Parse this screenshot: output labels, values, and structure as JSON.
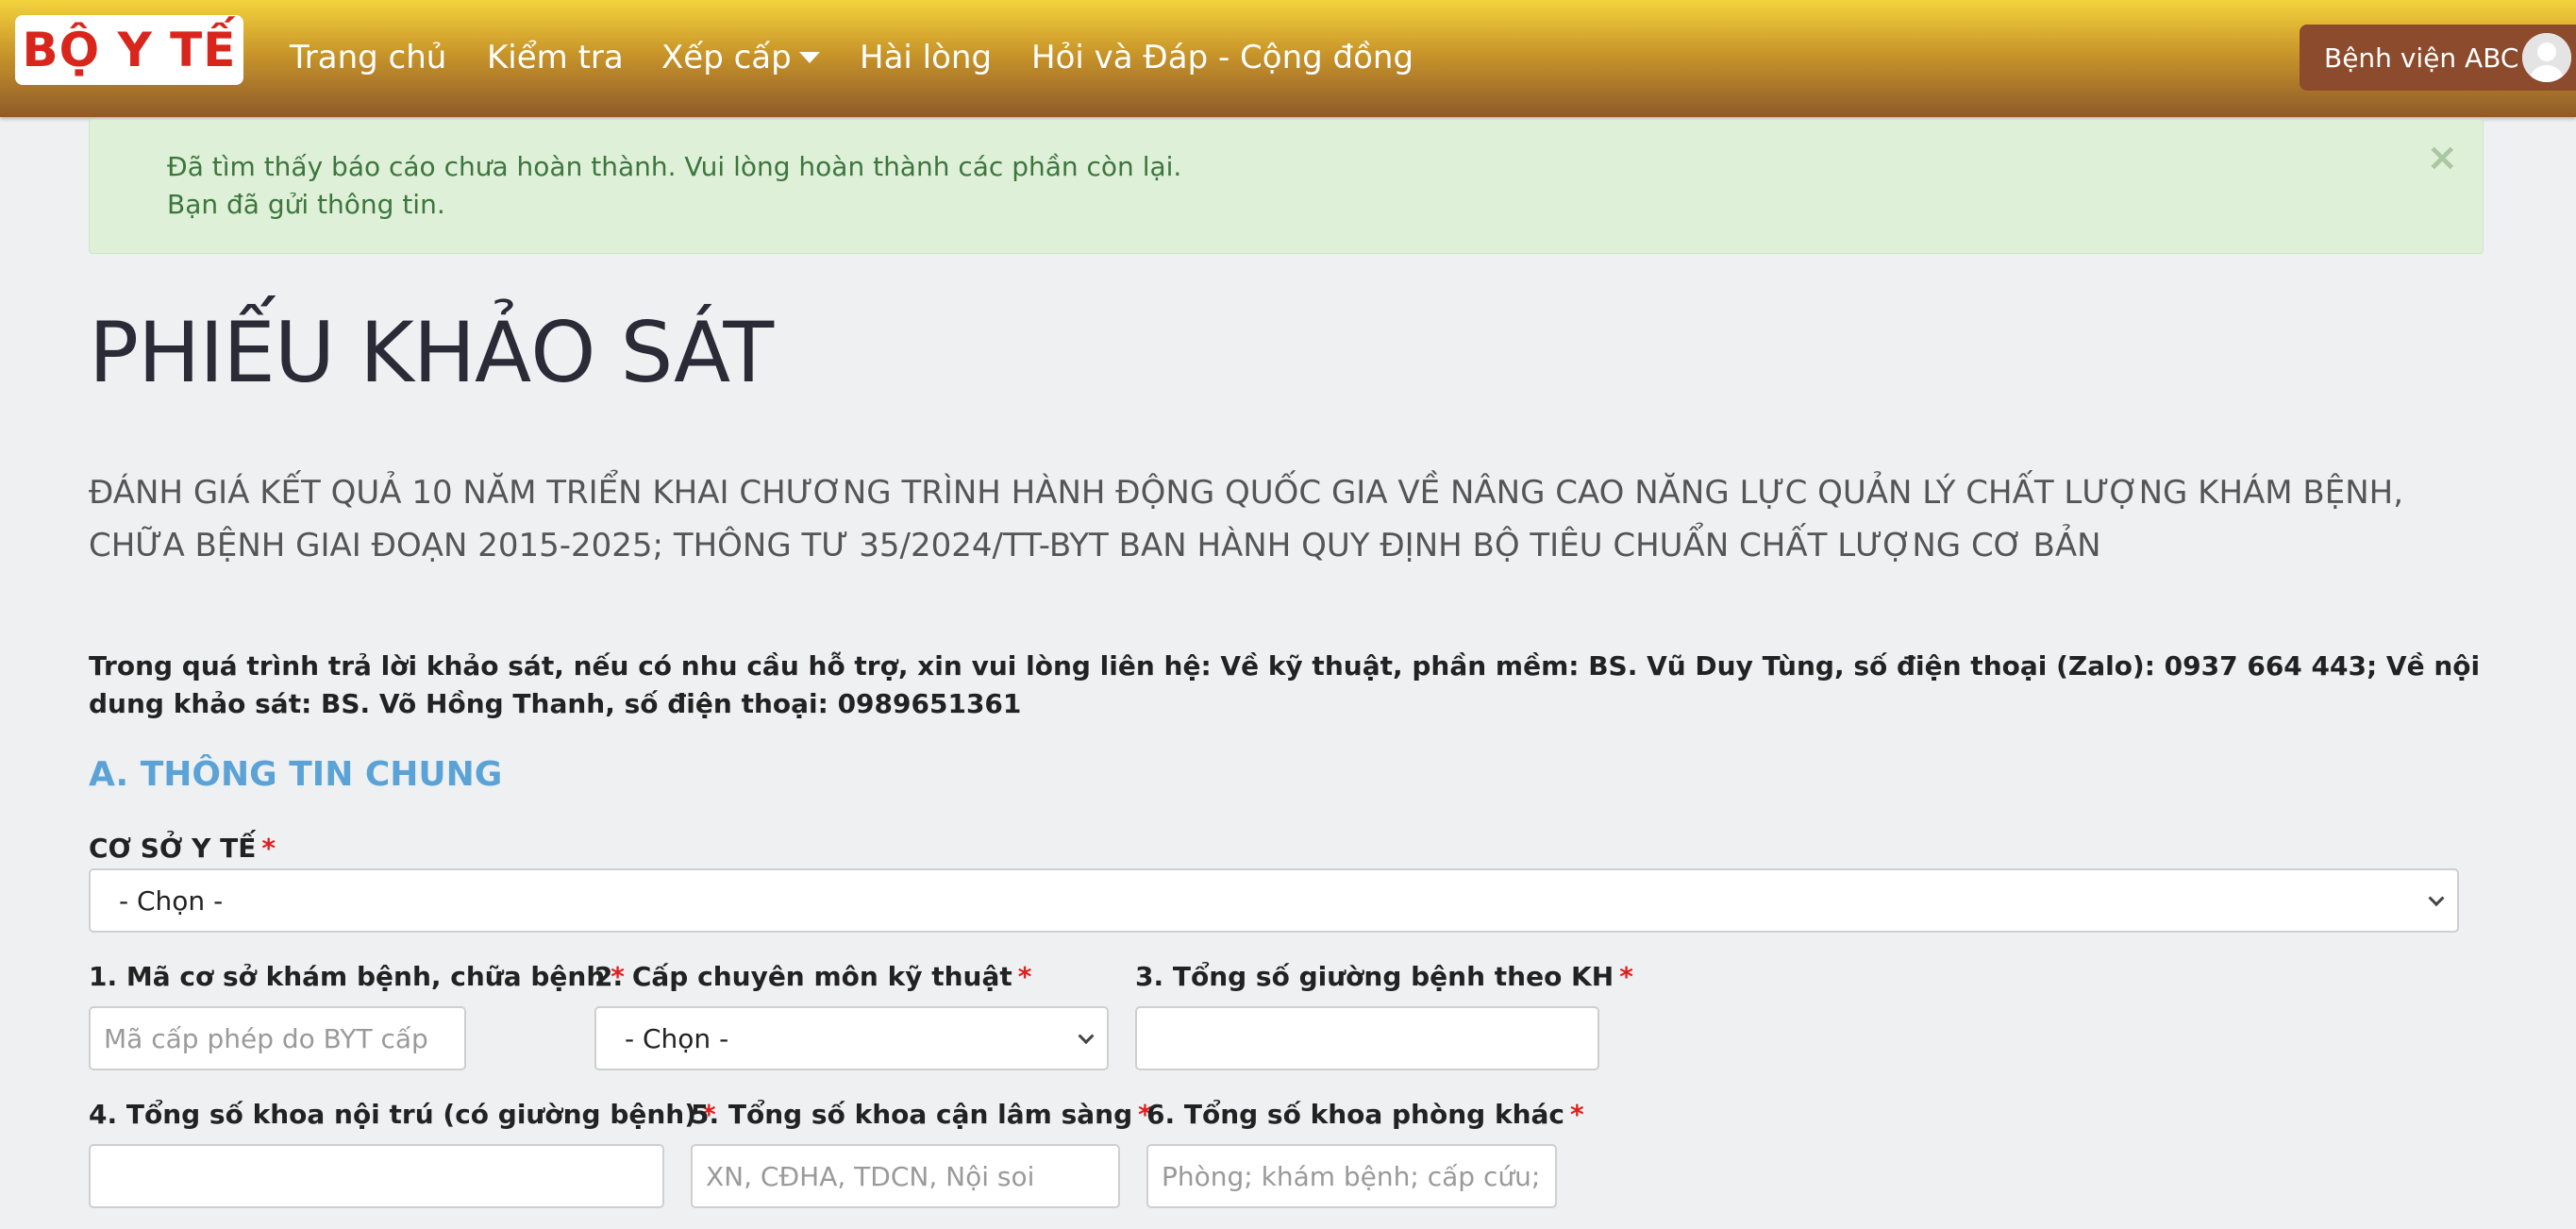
{
  "nav": {
    "logo_text": "BỘ Y TẾ",
    "items": [
      "Trang chủ",
      "Kiểm tra",
      "Xếp cấp",
      "Hài lòng",
      "Hỏi và Đáp - Cộng đồng"
    ],
    "user_label": "Bệnh viện ABC"
  },
  "alert": {
    "line1": "Đã tìm thấy báo cáo chưa hoàn thành. Vui lòng hoàn thành các phần còn lại.",
    "line2": "Bạn đã gửi thông tin.",
    "close": "×"
  },
  "page": {
    "title": "PHIẾU KHẢO SÁT",
    "subtitle": "ĐÁNH GIÁ KẾT QUẢ 10 NĂM TRIỂN KHAI CHƯƠNG TRÌNH HÀNH ĐỘNG QUỐC GIA VỀ NÂNG CAO NĂNG LỰC QUẢN LÝ CHẤT LƯỢNG KHÁM BỆNH, CHỮA BỆNH GIAI ĐOẠN 2015-2025; THÔNG TƯ 35/2024/TT-BYT BAN HÀNH QUY ĐỊNH BỘ TIÊU CHUẨN CHẤT LƯỢNG CƠ BẢN",
    "note": "Trong quá trình trả lời khảo sát, nếu có nhu cầu hỗ trợ, xin vui lòng liên hệ: Về kỹ thuật, phần mềm: BS. Vũ Duy Tùng, số điện thoại (Zalo): 0937 664 443; Về nội dung khảo sát: BS. Võ Hồng Thanh, số điện thoại: 0989651361",
    "section_a": "A. THÔNG TIN CHUNG"
  },
  "form": {
    "required_mark": "*",
    "facility": {
      "label": "CƠ SỞ Y TẾ",
      "value": "- Chọn -"
    },
    "f1": {
      "label": "1. Mã cơ sở khám bệnh, chữa bệnh",
      "placeholder": "Mã cấp phép do BYT cấp"
    },
    "f2": {
      "label": "2. Cấp chuyên môn kỹ thuật",
      "value": "- Chọn -"
    },
    "f3": {
      "label": "3. Tổng số giường bệnh theo KH",
      "placeholder": ""
    },
    "f4": {
      "label": "4. Tổng số khoa nội trú (có giường bệnh)",
      "placeholder": ""
    },
    "f5": {
      "label": "5. Tổng số khoa cận lâm sàng",
      "placeholder": "XN, CĐHA, TDCN, Nội soi"
    },
    "f6": {
      "label": "6. Tổng số khoa phòng khác",
      "placeholder": "Phòng; khám bệnh; cấp cứu; dược"
    }
  },
  "colors": {
    "nav_top": "#f4d33c",
    "nav_bottom": "#8f5a2a",
    "logo_red": "#d8261d",
    "alert_bg": "#dff0d8",
    "alert_text": "#3c763d",
    "section_blue": "#5ba3d6",
    "required_red": "#e02020"
  }
}
